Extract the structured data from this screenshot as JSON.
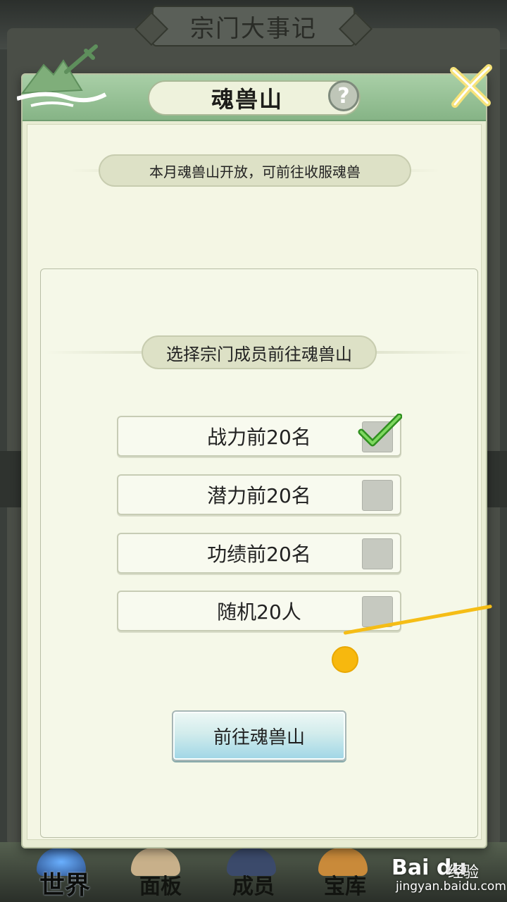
{
  "background": {
    "title": "宗门大事记",
    "nav": {
      "world": "世界",
      "panel": "面板",
      "members": "成员",
      "treasury": "宝库"
    }
  },
  "dialog": {
    "title": "魂兽山",
    "help_symbol": "?",
    "notice": "本月魂兽山开放，可前往收服魂兽",
    "section_title": "选择宗门成员前往魂兽山",
    "options": [
      {
        "label": "战力前20名",
        "checked": true
      },
      {
        "label": "潜力前20名",
        "checked": false
      },
      {
        "label": "功绩前20名",
        "checked": false
      },
      {
        "label": "随机20人",
        "checked": false
      }
    ],
    "go_button": "前往魂兽山"
  },
  "watermark": {
    "logo": "Bai du",
    "jingyan": "经验",
    "url": "jingyan.baidu.com"
  },
  "colors": {
    "header_green": "#86b486",
    "panel_bg": "#f5f8e8",
    "checkbox_gray": "#c6c9c0",
    "check_green": "#3fae2a",
    "pointer_yellow": "#f5bd16",
    "button_blue": "#9fd6e6"
  },
  "icons": {
    "help": "question-mark-icon",
    "close": "close-x-icon",
    "check": "checkmark-icon",
    "decor": "mountain-sword-icon"
  }
}
